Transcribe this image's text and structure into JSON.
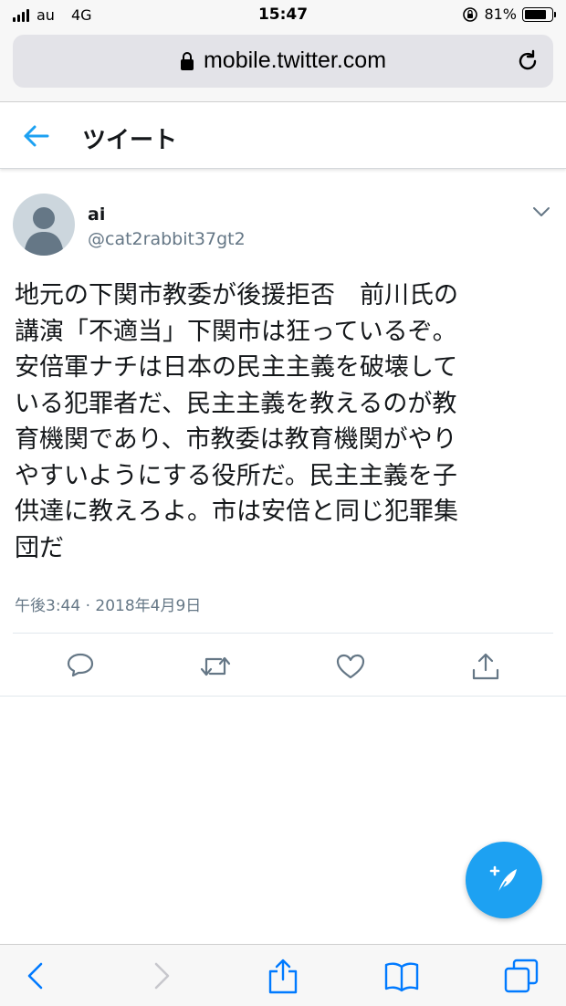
{
  "status_bar": {
    "carrier": "au",
    "network": "4G",
    "time": "15:47",
    "battery": "81%",
    "battery_level": 0.81
  },
  "browser": {
    "url": "mobile.twitter.com",
    "lock_icon": "lock-icon",
    "reload_icon": "reload-icon"
  },
  "header": {
    "title": "ツイート",
    "back_icon": "back-arrow-icon"
  },
  "tweet": {
    "name": "ai",
    "handle": "@cat2rabbit37gt2",
    "text": "地元の下関市教委が後援拒否　前川氏の\n講演「不適当」下関市は狂っているぞ。\n安倍軍ナチは日本の民主主義を破壊して\nいる犯罪者だ、民主主義を教えるのが教\n育機関であり、市教委は教育機関がやり\nやすいようにする役所だ。民主主義を子\n供達に教えろよ。市は安倍と同じ犯罪集\n団だ",
    "timestamp": "午後3:44 · 2018年4月9日"
  },
  "actions": [
    "reply-icon",
    "retweet-icon",
    "like-icon",
    "share-icon"
  ],
  "colors": {
    "accent": "#1da1f2",
    "text": "#14171a",
    "muted": "#657786",
    "safari_blue": "#007aff"
  },
  "toolbar": [
    "back-icon",
    "forward-icon",
    "share-icon",
    "bookmarks-icon",
    "tabs-icon"
  ]
}
